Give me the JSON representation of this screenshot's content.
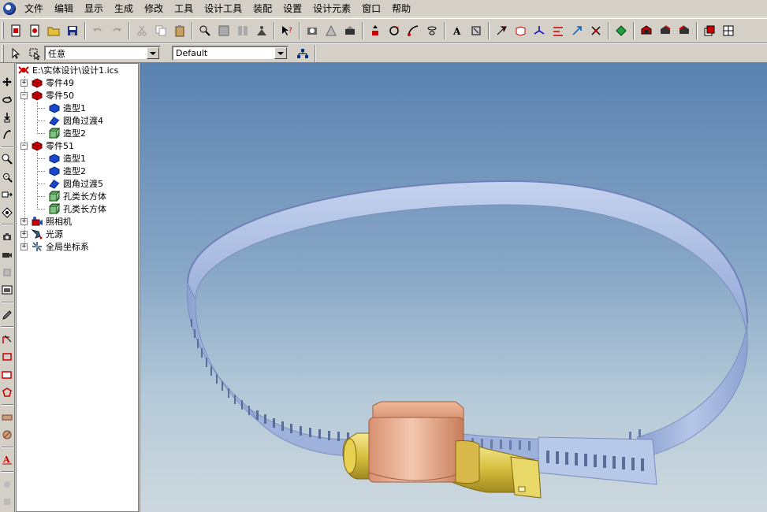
{
  "menubar": {
    "items": [
      "文件",
      "编辑",
      "显示",
      "生成",
      "修改",
      "工具",
      "设计工具",
      "装配",
      "设置",
      "设计元素",
      "窗口",
      "帮助"
    ]
  },
  "toolbar2": {
    "filter_value": "任意",
    "style_value": "Default"
  },
  "tree": {
    "root": "E:\\实体设计\\设计1.ics",
    "part49": "零件49",
    "part50": "零件50",
    "part50_children": [
      "造型1",
      "圆角过渡4",
      "造型2"
    ],
    "part51": "零件51",
    "part51_children": [
      "造型1",
      "造型2",
      "圆角过渡5",
      "孔类长方体",
      "孔类长方体"
    ],
    "camera": "照相机",
    "light": "光源",
    "global_coords": "全局坐标系"
  },
  "colors": {
    "band": "#a4b8e0",
    "band_edge": "#7a8fc0",
    "housing": "#e0a080",
    "screw": "#e8d060",
    "viewport_top": "#5a82b0",
    "viewport_bottom": "#cdd8de"
  }
}
